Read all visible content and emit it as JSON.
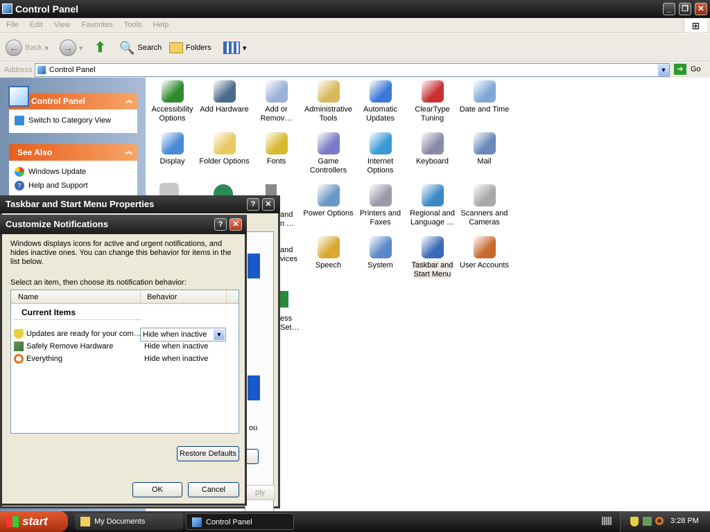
{
  "window": {
    "title": "Control Panel"
  },
  "menu": [
    "File",
    "Edit",
    "View",
    "Favorites",
    "Tools",
    "Help"
  ],
  "toolbar": {
    "back": "Back",
    "search": "Search",
    "folders": "Folders"
  },
  "address": {
    "label": "Address",
    "value": "Control Panel",
    "go": "Go"
  },
  "left_panel": {
    "cp_title": "Control Panel",
    "switch_link": "Switch to Category View",
    "see_also_title": "See Also",
    "see_also": [
      "Windows Update",
      "Help and Support"
    ]
  },
  "icons": [
    {
      "label": "Accessibility Options",
      "icon": "accessibility-icon",
      "color": "#2e8b2e"
    },
    {
      "label": "Add Hardware",
      "icon": "add-hardware-icon",
      "color": "#4a6b8c"
    },
    {
      "label": "Add or Remov…",
      "icon": "add-remove-programs-icon",
      "color": "#9ab2d8"
    },
    {
      "label": "Administrative Tools",
      "icon": "administrative-tools-icon",
      "color": "#d8b85a"
    },
    {
      "label": "Automatic Updates",
      "icon": "automatic-updates-icon",
      "color": "#3a78d8"
    },
    {
      "label": "ClearType Tuning",
      "icon": "cleartype-icon",
      "color": "#c83030"
    },
    {
      "label": "Date and Time",
      "icon": "date-time-icon",
      "color": "#7fa7d8"
    },
    {
      "label": "Display",
      "icon": "display-icon",
      "color": "#4a88d8"
    },
    {
      "label": "Folder Options",
      "icon": "folder-options-icon",
      "color": "#e8c860"
    },
    {
      "label": "Fonts",
      "icon": "fonts-icon",
      "color": "#d8b830"
    },
    {
      "label": "Game Controllers",
      "icon": "game-controllers-icon",
      "color": "#7a7ac8"
    },
    {
      "label": "Internet Options",
      "icon": "internet-options-icon",
      "color": "#3a9ad8"
    },
    {
      "label": "Keyboard",
      "icon": "keyboard-icon",
      "color": "#8a8aa8"
    },
    {
      "label": "Mail",
      "icon": "mail-icon",
      "color": "#6a88b8"
    },
    {
      "label": "Power Options",
      "icon": "power-options-icon",
      "color": "#6a98c8"
    },
    {
      "label": "Printers and Faxes",
      "icon": "printers-faxes-icon",
      "color": "#9a9aa8"
    },
    {
      "label": "Regional and Language …",
      "icon": "regional-language-icon",
      "color": "#3a88c8"
    },
    {
      "label": "Scanners and Cameras",
      "icon": "scanners-cameras-icon",
      "color": "#a8a8a8"
    },
    {
      "label": "Speech",
      "icon": "speech-icon",
      "color": "#d8a830"
    },
    {
      "label": "System",
      "icon": "system-icon",
      "color": "#5a88c8"
    },
    {
      "label": "Taskbar and Start Menu",
      "icon": "taskbar-start-menu-icon",
      "color": "#3a6ab8"
    },
    {
      "label": "User Accounts",
      "icon": "user-accounts-icon",
      "color": "#c86a30"
    }
  ],
  "partial_labels": [
    "and",
    "n …",
    "and",
    "vices",
    "ess",
    "Set…"
  ],
  "taskbar_dialog": {
    "title": "Taskbar and Start Menu Properties",
    "apply_partial": "ply",
    "ou_partial": "ou"
  },
  "notify_dialog": {
    "title": "Customize Notifications",
    "description": "Windows displays icons for active and urgent notifications, and hides inactive ones. You can change this behavior for items in the list below.",
    "instruction": "Select an item, then choose its notification behavior:",
    "col_name": "Name",
    "col_behavior": "Behavior",
    "group": "Current Items",
    "items": [
      {
        "name": "Updates are ready for your com…",
        "behavior": "Hide when inactive",
        "icon": "shield-icon"
      },
      {
        "name": "Safely Remove Hardware",
        "behavior": "Hide when inactive",
        "icon": "hardware-icon"
      },
      {
        "name": "Everything",
        "behavior": "Hide when inactive",
        "icon": "magnifier-icon"
      }
    ],
    "restore": "Restore Defaults",
    "ok": "OK",
    "cancel": "Cancel"
  },
  "taskbar": {
    "start": "start",
    "items": [
      "My Documents",
      "Control Panel"
    ],
    "clock": "3:28 PM"
  }
}
